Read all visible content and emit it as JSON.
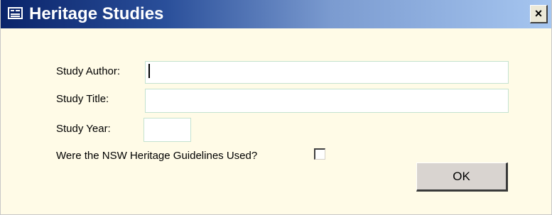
{
  "window": {
    "title": "Heritage Studies",
    "close_glyph": "×",
    "title_icon": "form-icon",
    "close_icon": "close-icon"
  },
  "form": {
    "study_author": {
      "label": "Study Author:",
      "value": ""
    },
    "study_title": {
      "label": "Study Title:",
      "value": ""
    },
    "study_year": {
      "label": "Study Year:",
      "value": ""
    },
    "guidelines": {
      "label": "Were the NSW Heritage Guidelines Used?",
      "checked": false
    },
    "ok_label": "OK"
  },
  "colors": {
    "title_bar_start": "#0a246a",
    "title_bar_end": "#a6c6f0",
    "form_background": "#fffbe7",
    "field_border": "#c4e2cf"
  }
}
